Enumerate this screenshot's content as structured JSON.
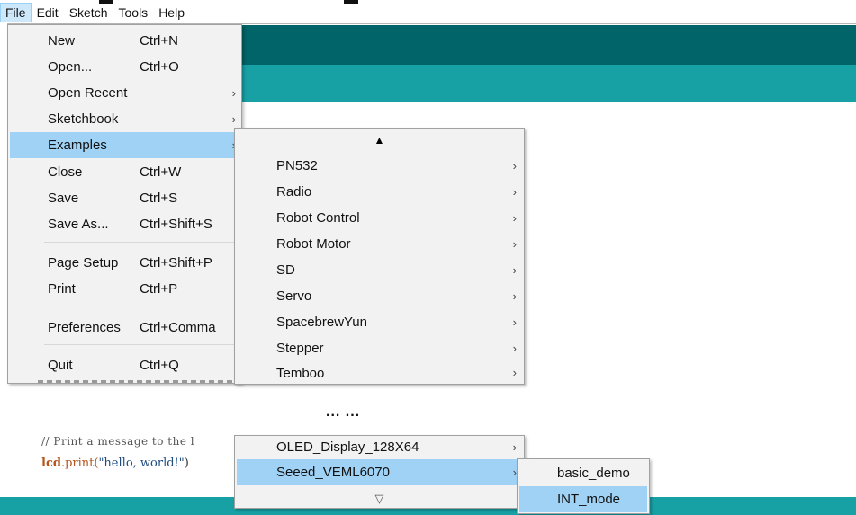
{
  "menubar": {
    "items": [
      "File",
      "Edit",
      "Sketch",
      "Tools",
      "Help"
    ]
  },
  "file_menu": {
    "items": [
      {
        "label": "New",
        "shortcut": "Ctrl+N"
      },
      {
        "label": "Open...",
        "shortcut": "Ctrl+O"
      },
      {
        "label": "Open Recent",
        "arrow": "›"
      },
      {
        "label": "Sketchbook",
        "arrow": "›"
      },
      {
        "label": "Examples",
        "arrow": "›"
      },
      {
        "label": "Close",
        "shortcut": "Ctrl+W"
      },
      {
        "label": "Save",
        "shortcut": "Ctrl+S"
      },
      {
        "label": "Save As...",
        "shortcut": "Ctrl+Shift+S"
      },
      {
        "label": "Page Setup",
        "shortcut": "Ctrl+Shift+P"
      },
      {
        "label": "Print",
        "shortcut": "Ctrl+P"
      },
      {
        "label": "Preferences",
        "shortcut": "Ctrl+Comma"
      },
      {
        "label": "Quit",
        "shortcut": "Ctrl+Q"
      }
    ]
  },
  "examples_menu": {
    "scroll_up": "▲",
    "items": [
      "PN532",
      "Radio",
      "Robot Control",
      "Robot Motor",
      "SD",
      "Servo",
      "SpacebrewYun",
      "Stepper",
      "Temboo"
    ],
    "arrow": "›"
  },
  "ellipsis": "... ...",
  "examples_menu_lower": {
    "items": [
      "OLED_Display_128X64",
      "Seeed_VEML6070"
    ],
    "arrow": "›",
    "scroll_down": "▽"
  },
  "sub_menu": {
    "items": [
      "basic_demo",
      "INT_mode"
    ]
  },
  "code": {
    "comment": "// Print a message to the l",
    "stmt_obj": "lcd",
    "stmt_fn": ".print(",
    "stmt_str": "\"hello, world!\"",
    "stmt_end": ")"
  },
  "colors": {
    "toolbar_dark": "#006468",
    "toolbar_teal": "#17a1a5",
    "highlight": "#9fd2f5"
  }
}
